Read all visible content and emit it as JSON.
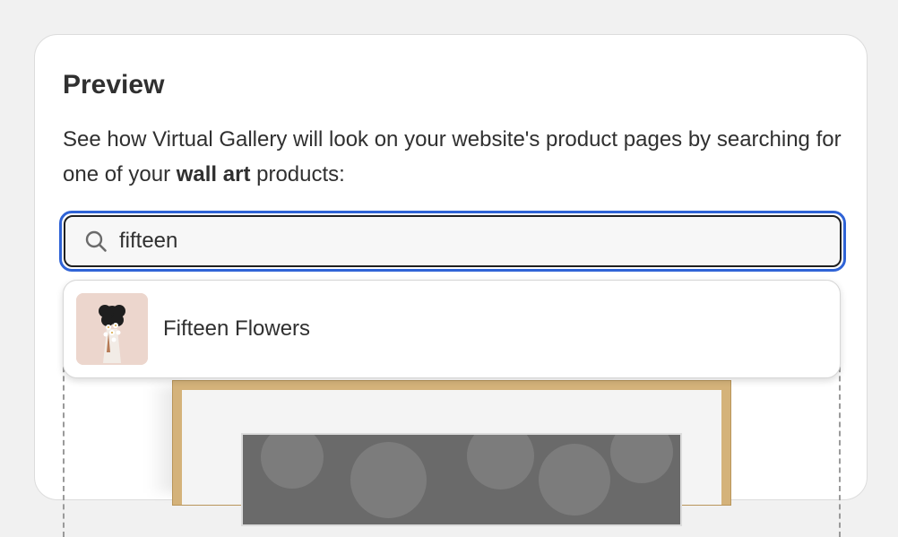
{
  "preview": {
    "title": "Preview",
    "description_part1": "See how Virtual Gallery will look on your website's product pages by searching for one of your ",
    "description_bold": "wall art",
    "description_part2": " products:"
  },
  "search": {
    "value": "fifteen",
    "icon": "search-icon"
  },
  "results": [
    {
      "label": "Fifteen Flowers",
      "thumbnail": "flowers-artwork-thumbnail"
    }
  ],
  "colors": {
    "focus_ring": "#2f63d6",
    "frame_wood": "#d4b27a",
    "card_background": "#ffffff",
    "page_background": "#f1f1f1"
  }
}
